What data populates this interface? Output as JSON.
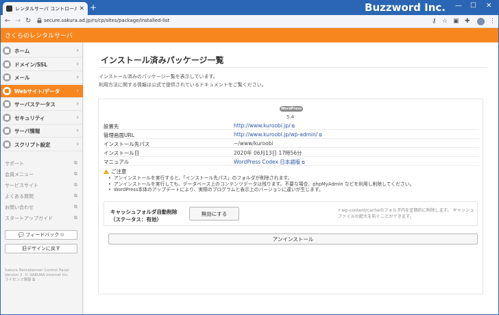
{
  "browser": {
    "tab_title": "レンタルサーバ コントロールパネル",
    "tab_close": "✕",
    "new_tab": "+",
    "url": "secure.sakura.ad.jp/rs/cp/sites/package/installed-list",
    "overlay_brand": "Buzzword Inc.",
    "win_min": "—",
    "win_max": "☐",
    "win_close": "✕"
  },
  "header": {
    "title": "さくらのレンタルサーバ"
  },
  "sidebar": {
    "menu": [
      {
        "label": "ホーム",
        "icon": "home-icon"
      },
      {
        "label": "ドメイン/SSL",
        "icon": "domain-icon"
      },
      {
        "label": "メール",
        "icon": "mail-icon"
      },
      {
        "label": "Webサイト/データ",
        "icon": "web-icon",
        "active": true
      },
      {
        "label": "サーバステータス",
        "icon": "status-icon"
      },
      {
        "label": "セキュリティ",
        "icon": "lock-icon"
      },
      {
        "label": "サーバ情報",
        "icon": "info-icon"
      },
      {
        "label": "スクリプト設定",
        "icon": "script-icon"
      }
    ],
    "links": [
      "サポート",
      "会員メニュー",
      "サービスサイト",
      "よくある質問",
      "お問い合わせ",
      "スタートアップガイド"
    ],
    "feedback_button": "フィードバック",
    "old_design_button": "旧デザインに戻す",
    "footer_line1": "Sakura Rentalserver Control Panel",
    "footer_line2": "Version 2. © SAKURA internet Inc.",
    "footer_license": "ライセンス情報"
  },
  "main": {
    "title": "インストール済みパッケージ一覧",
    "desc1": "インストール済みのパッケージ一覧を表示しています。",
    "desc2": "利用方法に関する情報は公式で提供されているドキュメントをご覧ください。",
    "package": {
      "badge": "WordPress",
      "version": "5.4",
      "rows": [
        {
          "label": "設置先",
          "value": "http://www.kuroobi.jp/",
          "link": true
        },
        {
          "label": "管理画面URL",
          "value": "http://www.kuroobi.jp/wp-admin/",
          "link": true
        },
        {
          "label": "インストール先パス",
          "value": "~/www/kuroobi",
          "link": false
        },
        {
          "label": "インストール日",
          "value": "2020年 06月13日 17時56分",
          "link": false
        },
        {
          "label": "マニュアル",
          "value": "WordPress Codex 日本語版",
          "link": true
        }
      ],
      "notice_title": "ご注意",
      "notices": [
        "アンインストールを実行すると、「インストール先パス」のフォルダが削除されます。",
        "アンインストールを実行しても、データベース上のコンテンツデータは残ります。不要な場合、phpMyAdmin などを利用し削除してください。",
        "WordPress本体のアップデートにより、実際のプログラムと表示上のバージョンに違いが生じます。"
      ],
      "cache_label_line1": "キャッシュフォルダ自動削除",
      "cache_label_line2": "（ステータス：有効）",
      "disable_button": "無効にする",
      "cache_note": "wp-content/cacheのフォルダ内を定期的に削除します。 キャッシュファイルの肥大を防ぐことができます。",
      "uninstall_button": "アンインストール"
    }
  },
  "colors": {
    "accent": "#f8861f",
    "browser": "#2a66b3",
    "link": "#2855a6"
  }
}
